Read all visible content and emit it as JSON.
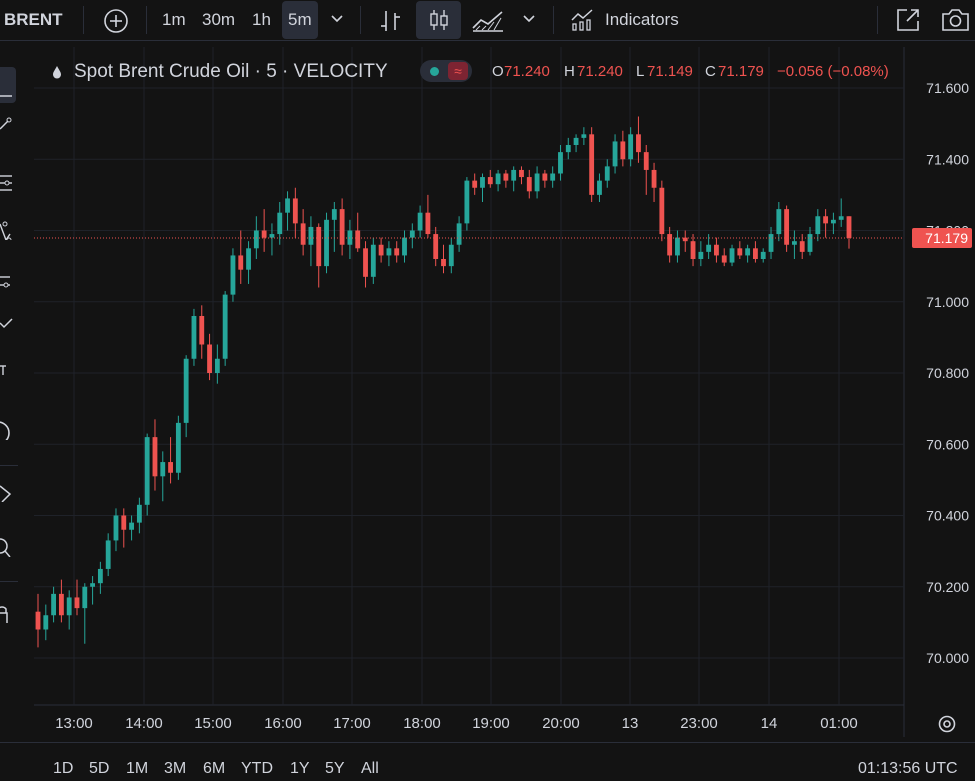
{
  "toolbar": {
    "symbol": "BRENT",
    "intervals": [
      "1m",
      "30m",
      "1h",
      "5m"
    ],
    "active_interval": "5m",
    "indicators_label": "Indicators",
    "icons": [
      "add-symbol-icon",
      "chevron-down-icon",
      "bar-chart-style-icon",
      "candles-style-icon",
      "area-chart-style-icon",
      "chevron-down-icon",
      "indicators-icon",
      "fullscreen-icon",
      "camera-icon"
    ]
  },
  "legend": {
    "title": "Spot Brent Crude Oil · 5 · VELOCITY",
    "o_label": "O",
    "o_value": "71.240",
    "h_label": "H",
    "h_value": "71.240",
    "l_label": "L",
    "l_value": "71.149",
    "c_label": "C",
    "c_value": "71.179",
    "change": "−0.056 (−0.08%)"
  },
  "colors": {
    "up": "#26a69a",
    "down": "#ef5350",
    "background": "#131313",
    "grid": "#1f2229",
    "text": "#d1d4dc",
    "price_line": "#ef5350"
  },
  "chart_data": {
    "type": "candlestick",
    "x_ticks": [
      "13:00",
      "14:00",
      "15:00",
      "16:00",
      "17:00",
      "18:00",
      "19:00",
      "20:00",
      "13",
      "23:00",
      "14",
      "01:00"
    ],
    "y_ticks": [
      "71.600",
      "71.400",
      "71.200",
      "71.000",
      "70.800",
      "70.600",
      "70.400",
      "70.200",
      "70.000"
    ],
    "ylim": [
      69.95,
      71.68
    ],
    "last_price": "71.179",
    "last_price_value": 71.179,
    "candles": [
      [
        70.13,
        70.18,
        70.03,
        70.08
      ],
      [
        70.08,
        70.15,
        70.05,
        70.12
      ],
      [
        70.12,
        70.2,
        70.1,
        70.18
      ],
      [
        70.18,
        70.22,
        70.1,
        70.12
      ],
      [
        70.12,
        70.19,
        70.08,
        70.17
      ],
      [
        70.17,
        70.22,
        70.12,
        70.14
      ],
      [
        70.14,
        70.21,
        70.04,
        70.2
      ],
      [
        70.2,
        70.23,
        70.15,
        70.21
      ],
      [
        70.21,
        70.27,
        70.18,
        70.25
      ],
      [
        70.25,
        70.35,
        70.23,
        70.33
      ],
      [
        70.33,
        70.42,
        70.3,
        70.4
      ],
      [
        70.4,
        70.42,
        70.31,
        70.36
      ],
      [
        70.36,
        70.4,
        70.33,
        70.38
      ],
      [
        70.38,
        70.45,
        70.35,
        70.43
      ],
      [
        70.43,
        70.63,
        70.4,
        70.62
      ],
      [
        70.62,
        70.67,
        70.47,
        70.51
      ],
      [
        70.51,
        70.58,
        70.44,
        70.55
      ],
      [
        70.55,
        70.62,
        70.49,
        70.52
      ],
      [
        70.52,
        70.68,
        70.5,
        70.66
      ],
      [
        70.66,
        70.85,
        70.62,
        70.84
      ],
      [
        70.84,
        70.98,
        70.82,
        70.96
      ],
      [
        70.96,
        70.99,
        70.84,
        70.88
      ],
      [
        70.88,
        70.91,
        70.78,
        70.8
      ],
      [
        70.8,
        70.88,
        70.77,
        70.84
      ],
      [
        70.84,
        71.03,
        70.82,
        71.02
      ],
      [
        71.02,
        71.15,
        71.0,
        71.13
      ],
      [
        71.13,
        71.2,
        71.05,
        71.09
      ],
      [
        71.09,
        71.17,
        71.05,
        71.15
      ],
      [
        71.15,
        71.24,
        71.12,
        71.2
      ],
      [
        71.2,
        71.26,
        71.14,
        71.18
      ],
      [
        71.18,
        71.22,
        71.13,
        71.19
      ],
      [
        71.19,
        71.28,
        71.16,
        71.25
      ],
      [
        71.25,
        71.31,
        71.2,
        71.29
      ],
      [
        71.29,
        71.32,
        71.18,
        71.22
      ],
      [
        71.22,
        71.26,
        71.13,
        71.16
      ],
      [
        71.16,
        71.24,
        71.1,
        71.21
      ],
      [
        71.21,
        71.22,
        71.04,
        71.1
      ],
      [
        71.1,
        71.25,
        71.08,
        71.23
      ],
      [
        71.23,
        71.28,
        71.14,
        71.26
      ],
      [
        71.26,
        71.29,
        71.13,
        71.16
      ],
      [
        71.16,
        71.23,
        71.12,
        71.2
      ],
      [
        71.2,
        71.25,
        71.14,
        71.15
      ],
      [
        71.15,
        71.17,
        71.04,
        71.07
      ],
      [
        71.07,
        71.18,
        71.05,
        71.16
      ],
      [
        71.16,
        71.18,
        71.11,
        71.13
      ],
      [
        71.13,
        71.17,
        71.1,
        71.15
      ],
      [
        71.15,
        71.17,
        71.11,
        71.13
      ],
      [
        71.13,
        71.2,
        71.11,
        71.18
      ],
      [
        71.18,
        71.22,
        71.15,
        71.2
      ],
      [
        71.2,
        71.27,
        71.18,
        71.25
      ],
      [
        71.25,
        71.3,
        71.18,
        71.19
      ],
      [
        71.19,
        71.21,
        71.1,
        71.12
      ],
      [
        71.12,
        71.16,
        71.08,
        71.1
      ],
      [
        71.1,
        71.18,
        71.08,
        71.16
      ],
      [
        71.16,
        71.24,
        71.14,
        71.22
      ],
      [
        71.22,
        71.35,
        71.2,
        71.34
      ],
      [
        71.34,
        71.36,
        71.3,
        71.32
      ],
      [
        71.32,
        71.36,
        71.28,
        71.35
      ],
      [
        71.35,
        71.37,
        71.32,
        71.33
      ],
      [
        71.33,
        71.37,
        71.31,
        71.36
      ],
      [
        71.36,
        71.37,
        71.32,
        71.34
      ],
      [
        71.34,
        71.38,
        71.31,
        71.37
      ],
      [
        71.37,
        71.38,
        71.33,
        71.35
      ],
      [
        71.35,
        71.37,
        71.29,
        71.31
      ],
      [
        71.31,
        71.38,
        71.29,
        71.36
      ],
      [
        71.36,
        71.37,
        71.32,
        71.34
      ],
      [
        71.34,
        71.38,
        71.32,
        71.36
      ],
      [
        71.36,
        71.44,
        71.34,
        71.42
      ],
      [
        71.42,
        71.46,
        71.4,
        71.44
      ],
      [
        71.44,
        71.47,
        71.42,
        71.46
      ],
      [
        71.46,
        71.49,
        71.44,
        71.47
      ],
      [
        71.47,
        71.49,
        71.28,
        71.3
      ],
      [
        71.3,
        71.36,
        71.28,
        71.34
      ],
      [
        71.34,
        71.4,
        71.32,
        71.38
      ],
      [
        71.38,
        71.47,
        71.36,
        71.45
      ],
      [
        71.45,
        71.48,
        71.38,
        71.4
      ],
      [
        71.4,
        71.49,
        71.38,
        71.47
      ],
      [
        71.47,
        71.52,
        71.39,
        71.42
      ],
      [
        71.42,
        71.44,
        71.3,
        71.37
      ],
      [
        71.37,
        71.39,
        71.28,
        71.32
      ],
      [
        71.32,
        71.34,
        71.17,
        71.19
      ],
      [
        71.19,
        71.21,
        71.11,
        71.13
      ],
      [
        71.13,
        71.2,
        71.11,
        71.18
      ],
      [
        71.18,
        71.2,
        71.14,
        71.17
      ],
      [
        71.17,
        71.19,
        71.1,
        71.12
      ],
      [
        71.12,
        71.17,
        71.1,
        71.14
      ],
      [
        71.14,
        71.19,
        71.12,
        71.16
      ],
      [
        71.16,
        71.18,
        71.11,
        71.13
      ],
      [
        71.13,
        71.15,
        71.1,
        71.11
      ],
      [
        71.11,
        71.16,
        71.1,
        71.15
      ],
      [
        71.15,
        71.17,
        71.12,
        71.13
      ],
      [
        71.13,
        71.16,
        71.11,
        71.15
      ],
      [
        71.15,
        71.17,
        71.11,
        71.12
      ],
      [
        71.12,
        71.15,
        71.11,
        71.14
      ],
      [
        71.14,
        71.21,
        71.12,
        71.19
      ],
      [
        71.19,
        71.28,
        71.17,
        71.26
      ],
      [
        71.26,
        71.27,
        71.14,
        71.16
      ],
      [
        71.16,
        71.2,
        71.12,
        71.17
      ],
      [
        71.17,
        71.19,
        71.12,
        71.14
      ],
      [
        71.14,
        71.21,
        71.13,
        71.19
      ],
      [
        71.19,
        71.26,
        71.17,
        71.24
      ],
      [
        71.24,
        71.26,
        71.18,
        71.22
      ],
      [
        71.22,
        71.25,
        71.19,
        71.23
      ],
      [
        71.23,
        71.29,
        71.21,
        71.24
      ],
      [
        71.24,
        71.24,
        71.149,
        71.179
      ]
    ]
  },
  "bottombar": {
    "ranges": [
      "1D",
      "5D",
      "1M",
      "3M",
      "6M",
      "YTD",
      "1Y",
      "5Y",
      "All"
    ],
    "clock": "01:13:56 UTC"
  }
}
